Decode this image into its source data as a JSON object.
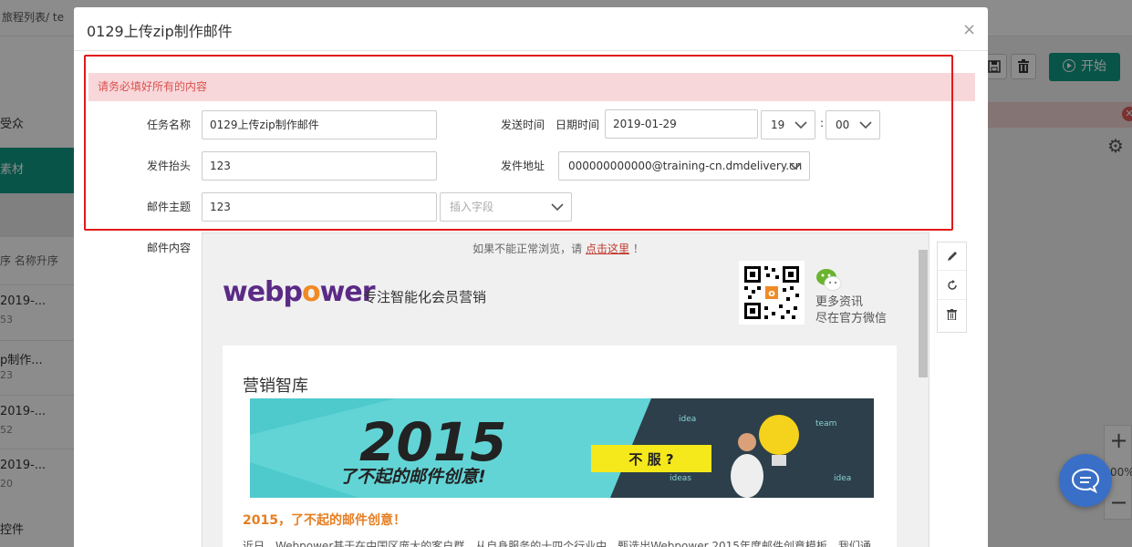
{
  "background": {
    "breadcrumb": "旅程列表/ te",
    "sidebar": {
      "item_audience": "受众",
      "item_material": "素材",
      "sort_label": "名称升序",
      "list": [
        {
          "title": "2019-...",
          "sub": "53"
        },
        {
          "title": "p制作...",
          "sub": "23"
        },
        {
          "title": "2019-...",
          "sub": "52"
        },
        {
          "title": "2019-...",
          "sub": "20"
        }
      ],
      "controls_label": "控件"
    },
    "toolbar": {
      "start_label": "开始"
    },
    "zoom": {
      "plus": "+",
      "value": "00%",
      "minus": "−"
    },
    "icons": {
      "save": "save-icon",
      "delete": "trash-icon",
      "start": "play-icon",
      "settings": "gear-icon",
      "chat": "chat-icon"
    }
  },
  "modal": {
    "title": "0129上传zip制作邮件",
    "close_symbol": "×",
    "alert": "请务必填好所有的内容",
    "form": {
      "task_name_label": "任务名称",
      "task_name_value": "0129上传zip制作邮件",
      "send_time_label": "发送时间",
      "date_time_label": "日期时间",
      "date_value": "2019-01-29",
      "hour_value": "19",
      "time_colon": ":",
      "minute_value": "00",
      "sender_label": "发件抬头",
      "sender_value": "123",
      "sender_addr_label": "发件地址",
      "sender_addr_value": "000000000000@training-cn.dmdelivery.cn",
      "subject_label": "邮件主题",
      "subject_value": "123",
      "insert_field_placeholder": "插入字段",
      "content_label": "邮件内容"
    },
    "preview": {
      "top_text": "如果不能正常浏览，请",
      "top_link": "点击这里",
      "top_end": "！",
      "logo_part1": "webp",
      "logo_part2": "o",
      "logo_part3": "wer",
      "slogan": "专注智能化会员营销",
      "more_info_line1": "更多资讯",
      "more_info_line2": "尽在官方微信",
      "card_title": "营销智库",
      "banner_year": "2015",
      "banner_tagline": "了不起的邮件创意!",
      "banner_button": "不 服 ?",
      "card_subtitle": "2015，了不起的邮件创意！",
      "card_body": "近日，Webpower基于在中国区庞大的客户群，从自身服务的十四个行业中，甄选出Webpower 2015年度邮件创意模板，我们通"
    },
    "tools": {
      "edit": "pencil-icon",
      "refresh": "refresh-icon",
      "delete": "trash-icon"
    }
  },
  "colors": {
    "accent": "#0f9a83",
    "alert_bg": "#f8d7da",
    "alert_text": "#d9534f",
    "highlight": "#e11a1a",
    "brand_purple": "#5b2a86",
    "brand_orange": "#f08a24"
  }
}
